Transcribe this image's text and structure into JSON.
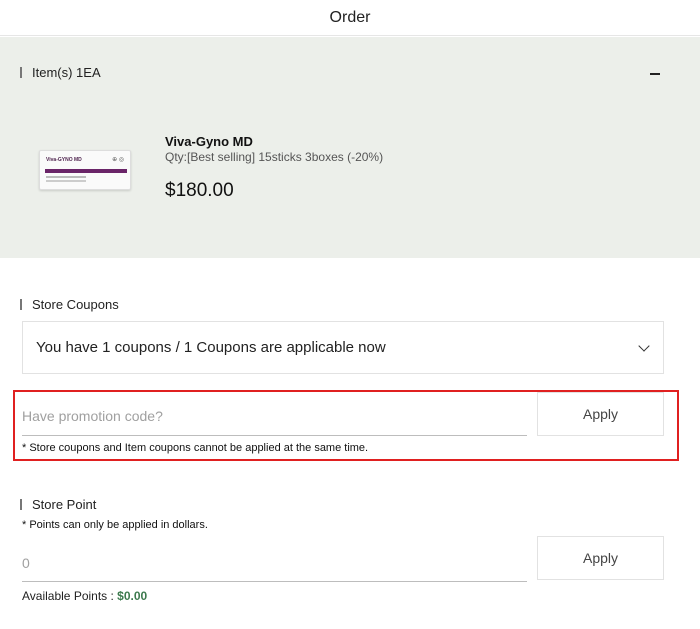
{
  "header": {
    "title": "Order"
  },
  "items": {
    "heading": "Item(s) 1EA",
    "collapse_icon": "minus-icon",
    "product": {
      "name": "Viva-Gyno MD",
      "qty": "Qty:[Best selling] 15sticks 3boxes (-20%)",
      "price": "$180.00",
      "thumb_title": "Viva-GYNO MD",
      "thumb_logo": "⊕ ◎"
    }
  },
  "coupons": {
    "heading": "Store Coupons",
    "select_value": "You have 1 coupons / 1 Coupons are applicable now",
    "promo_placeholder": "Have promotion code?",
    "apply_label": "Apply",
    "note": "* Store coupons and Item coupons cannot be applied at the same time."
  },
  "points": {
    "heading": "Store Point",
    "note": "* Points can only be applied in dollars.",
    "input_placeholder": "0",
    "apply_label": "Apply",
    "available_label": "Available Points : ",
    "available_value": "$0.00"
  },
  "colors": {
    "panel_bg": "#ecefea",
    "highlight": "#e02020",
    "points_value": "#3d7a4e"
  }
}
